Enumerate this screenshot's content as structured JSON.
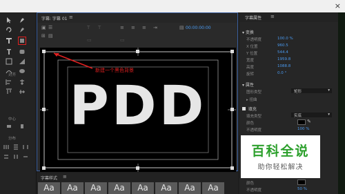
{
  "top_bar": {
    "close_label": "×"
  },
  "toolbar": {
    "labels": {
      "align": "对齐",
      "center": "中心",
      "distribute": "分布"
    }
  },
  "title_panel": {
    "tab_label": "字幕: 字幕 01",
    "menu_glyph": "≡",
    "timecode": "00:00:00:00",
    "headline": "PDD",
    "annotation": "新建一个黑色背景"
  },
  "title_properties": {
    "tab_label": "字幕属性",
    "menu_glyph": "≡",
    "transform": {
      "header": "变换",
      "rows": [
        {
          "label": "不透明度",
          "value": "100.0 %"
        },
        {
          "label": "X 位置",
          "value": "960.5"
        },
        {
          "label": "Y 位置",
          "value": "544.4"
        },
        {
          "label": "宽度",
          "value": "1959.8"
        },
        {
          "label": "高度",
          "value": "1088.8"
        },
        {
          "label": "旋转",
          "value": "0.0 °"
        }
      ]
    },
    "properties": {
      "header": "属性",
      "rows": [
        {
          "label": "图形类型",
          "value": "矩形"
        },
        {
          "label": "扭曲",
          "value": ""
        }
      ]
    },
    "fill": {
      "header": "填充",
      "rows": [
        {
          "label": "填充类型",
          "value": "实底"
        },
        {
          "label": "颜色",
          "value": ""
        },
        {
          "label": "不透明度",
          "value": "100 %"
        },
        {
          "label": "颜色",
          "value": ""
        },
        {
          "label": "不透明度",
          "value": "50 %"
        }
      ]
    }
  },
  "styles_panel": {
    "tab_label": "字幕样式",
    "menu_glyph": "≡",
    "samples": [
      "Aa",
      "Aa",
      "Aa",
      "Aa",
      "Aa",
      "Aa",
      "Aa",
      "Aa"
    ]
  },
  "watermark": {
    "main": "百科全说",
    "sub": "助你轻松解决"
  },
  "colors": {
    "accent_blue": "#4a9af0",
    "highlight_red": "#e02020",
    "brand_green": "#2ca02c"
  }
}
